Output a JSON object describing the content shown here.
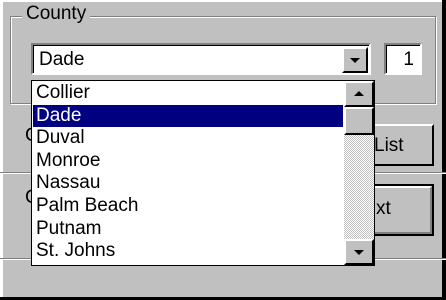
{
  "county_group": {
    "label": "County",
    "selected_value": "Dade",
    "count": "1"
  },
  "buttons": {
    "list_label_visible": "List",
    "next_label_visible": "xt"
  },
  "hidden_labels": {
    "first_char": "C",
    "second_char": "C"
  },
  "dropdown": {
    "items": [
      "Collier",
      "Dade",
      "Duval",
      "Monroe",
      "Nassau",
      "Palm Beach",
      "Putnam",
      "St. Johns"
    ],
    "selected_index": 1
  }
}
